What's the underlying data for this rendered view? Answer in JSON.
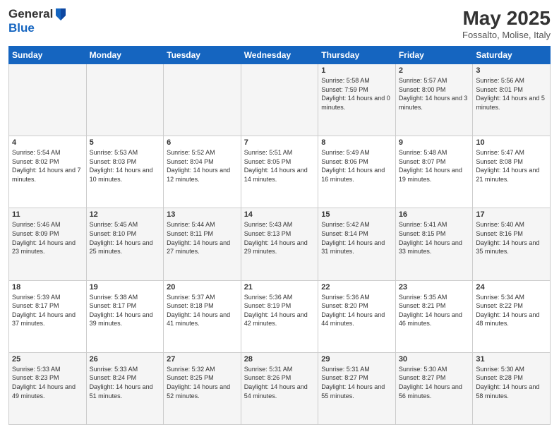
{
  "header": {
    "logo_line1": "General",
    "logo_line2": "Blue",
    "month": "May 2025",
    "location": "Fossalto, Molise, Italy"
  },
  "weekdays": [
    "Sunday",
    "Monday",
    "Tuesday",
    "Wednesday",
    "Thursday",
    "Friday",
    "Saturday"
  ],
  "weeks": [
    [
      {
        "day": "",
        "content": ""
      },
      {
        "day": "",
        "content": ""
      },
      {
        "day": "",
        "content": ""
      },
      {
        "day": "",
        "content": ""
      },
      {
        "day": "1",
        "content": "Sunrise: 5:58 AM\nSunset: 7:59 PM\nDaylight: 14 hours and 0 minutes."
      },
      {
        "day": "2",
        "content": "Sunrise: 5:57 AM\nSunset: 8:00 PM\nDaylight: 14 hours and 3 minutes."
      },
      {
        "day": "3",
        "content": "Sunrise: 5:56 AM\nSunset: 8:01 PM\nDaylight: 14 hours and 5 minutes."
      }
    ],
    [
      {
        "day": "4",
        "content": "Sunrise: 5:54 AM\nSunset: 8:02 PM\nDaylight: 14 hours and 7 minutes."
      },
      {
        "day": "5",
        "content": "Sunrise: 5:53 AM\nSunset: 8:03 PM\nDaylight: 14 hours and 10 minutes."
      },
      {
        "day": "6",
        "content": "Sunrise: 5:52 AM\nSunset: 8:04 PM\nDaylight: 14 hours and 12 minutes."
      },
      {
        "day": "7",
        "content": "Sunrise: 5:51 AM\nSunset: 8:05 PM\nDaylight: 14 hours and 14 minutes."
      },
      {
        "day": "8",
        "content": "Sunrise: 5:49 AM\nSunset: 8:06 PM\nDaylight: 14 hours and 16 minutes."
      },
      {
        "day": "9",
        "content": "Sunrise: 5:48 AM\nSunset: 8:07 PM\nDaylight: 14 hours and 19 minutes."
      },
      {
        "day": "10",
        "content": "Sunrise: 5:47 AM\nSunset: 8:08 PM\nDaylight: 14 hours and 21 minutes."
      }
    ],
    [
      {
        "day": "11",
        "content": "Sunrise: 5:46 AM\nSunset: 8:09 PM\nDaylight: 14 hours and 23 minutes."
      },
      {
        "day": "12",
        "content": "Sunrise: 5:45 AM\nSunset: 8:10 PM\nDaylight: 14 hours and 25 minutes."
      },
      {
        "day": "13",
        "content": "Sunrise: 5:44 AM\nSunset: 8:11 PM\nDaylight: 14 hours and 27 minutes."
      },
      {
        "day": "14",
        "content": "Sunrise: 5:43 AM\nSunset: 8:13 PM\nDaylight: 14 hours and 29 minutes."
      },
      {
        "day": "15",
        "content": "Sunrise: 5:42 AM\nSunset: 8:14 PM\nDaylight: 14 hours and 31 minutes."
      },
      {
        "day": "16",
        "content": "Sunrise: 5:41 AM\nSunset: 8:15 PM\nDaylight: 14 hours and 33 minutes."
      },
      {
        "day": "17",
        "content": "Sunrise: 5:40 AM\nSunset: 8:16 PM\nDaylight: 14 hours and 35 minutes."
      }
    ],
    [
      {
        "day": "18",
        "content": "Sunrise: 5:39 AM\nSunset: 8:17 PM\nDaylight: 14 hours and 37 minutes."
      },
      {
        "day": "19",
        "content": "Sunrise: 5:38 AM\nSunset: 8:17 PM\nDaylight: 14 hours and 39 minutes."
      },
      {
        "day": "20",
        "content": "Sunrise: 5:37 AM\nSunset: 8:18 PM\nDaylight: 14 hours and 41 minutes."
      },
      {
        "day": "21",
        "content": "Sunrise: 5:36 AM\nSunset: 8:19 PM\nDaylight: 14 hours and 42 minutes."
      },
      {
        "day": "22",
        "content": "Sunrise: 5:36 AM\nSunset: 8:20 PM\nDaylight: 14 hours and 44 minutes."
      },
      {
        "day": "23",
        "content": "Sunrise: 5:35 AM\nSunset: 8:21 PM\nDaylight: 14 hours and 46 minutes."
      },
      {
        "day": "24",
        "content": "Sunrise: 5:34 AM\nSunset: 8:22 PM\nDaylight: 14 hours and 48 minutes."
      }
    ],
    [
      {
        "day": "25",
        "content": "Sunrise: 5:33 AM\nSunset: 8:23 PM\nDaylight: 14 hours and 49 minutes."
      },
      {
        "day": "26",
        "content": "Sunrise: 5:33 AM\nSunset: 8:24 PM\nDaylight: 14 hours and 51 minutes."
      },
      {
        "day": "27",
        "content": "Sunrise: 5:32 AM\nSunset: 8:25 PM\nDaylight: 14 hours and 52 minutes."
      },
      {
        "day": "28",
        "content": "Sunrise: 5:31 AM\nSunset: 8:26 PM\nDaylight: 14 hours and 54 minutes."
      },
      {
        "day": "29",
        "content": "Sunrise: 5:31 AM\nSunset: 8:27 PM\nDaylight: 14 hours and 55 minutes."
      },
      {
        "day": "30",
        "content": "Sunrise: 5:30 AM\nSunset: 8:27 PM\nDaylight: 14 hours and 56 minutes."
      },
      {
        "day": "31",
        "content": "Sunrise: 5:30 AM\nSunset: 8:28 PM\nDaylight: 14 hours and 58 minutes."
      }
    ]
  ]
}
